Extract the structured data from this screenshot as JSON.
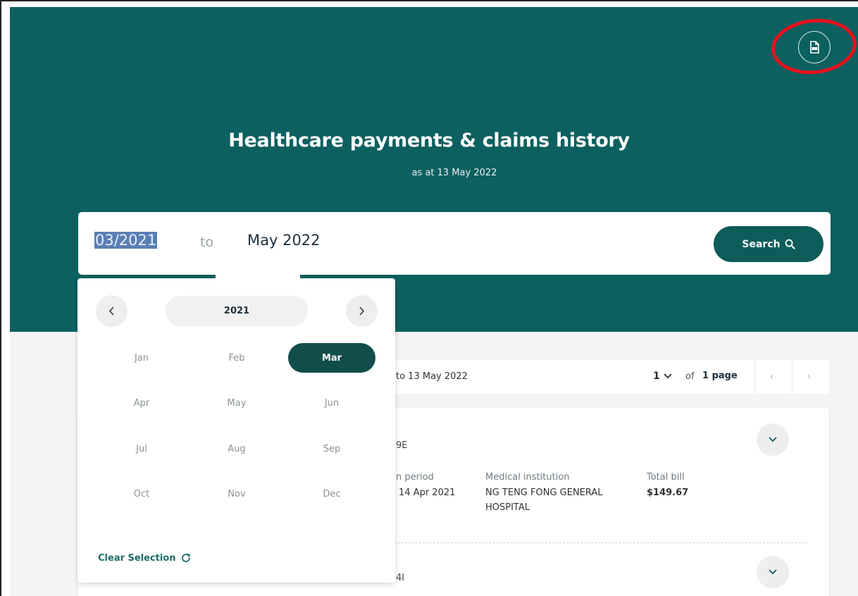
{
  "header": {
    "title": "Healthcare payments & claims history",
    "subtitle": "as at 13 May 2022",
    "download_icon": "pdf-download-icon"
  },
  "search": {
    "from_value": "03/2021",
    "to_label": "to",
    "to_value": "May 2022",
    "button_label": "Search",
    "button_icon": "search-icon"
  },
  "month_picker": {
    "year": "2021",
    "months": [
      "Jan",
      "Feb",
      "Mar",
      "Apr",
      "May",
      "Jun",
      "Jul",
      "Aug",
      "Sep",
      "Oct",
      "Nov",
      "Dec"
    ],
    "selected_month": "Mar",
    "clear_label": "Clear Selection"
  },
  "results": {
    "range_text": "to 13 May 2022",
    "current_page": "1",
    "of_label": "of",
    "total_pages": "1 page",
    "prev_icon": "‹",
    "next_icon": "›"
  },
  "records": [
    {
      "ref": "9E",
      "period_label": "n period",
      "period_value": "14 Apr 2021",
      "institution_label": "Medical institution",
      "institution_value": "NG TENG FONG GENERAL HOSPITAL",
      "bill_label": "Total bill",
      "bill_value": "$149.67"
    },
    {
      "ref": "4I"
    }
  ],
  "colors": {
    "header_bg": "#0d6060",
    "button_bg": "#0d5c5a",
    "selected_month_bg": "#114d4b",
    "annotation_ring": "#e6121e"
  }
}
